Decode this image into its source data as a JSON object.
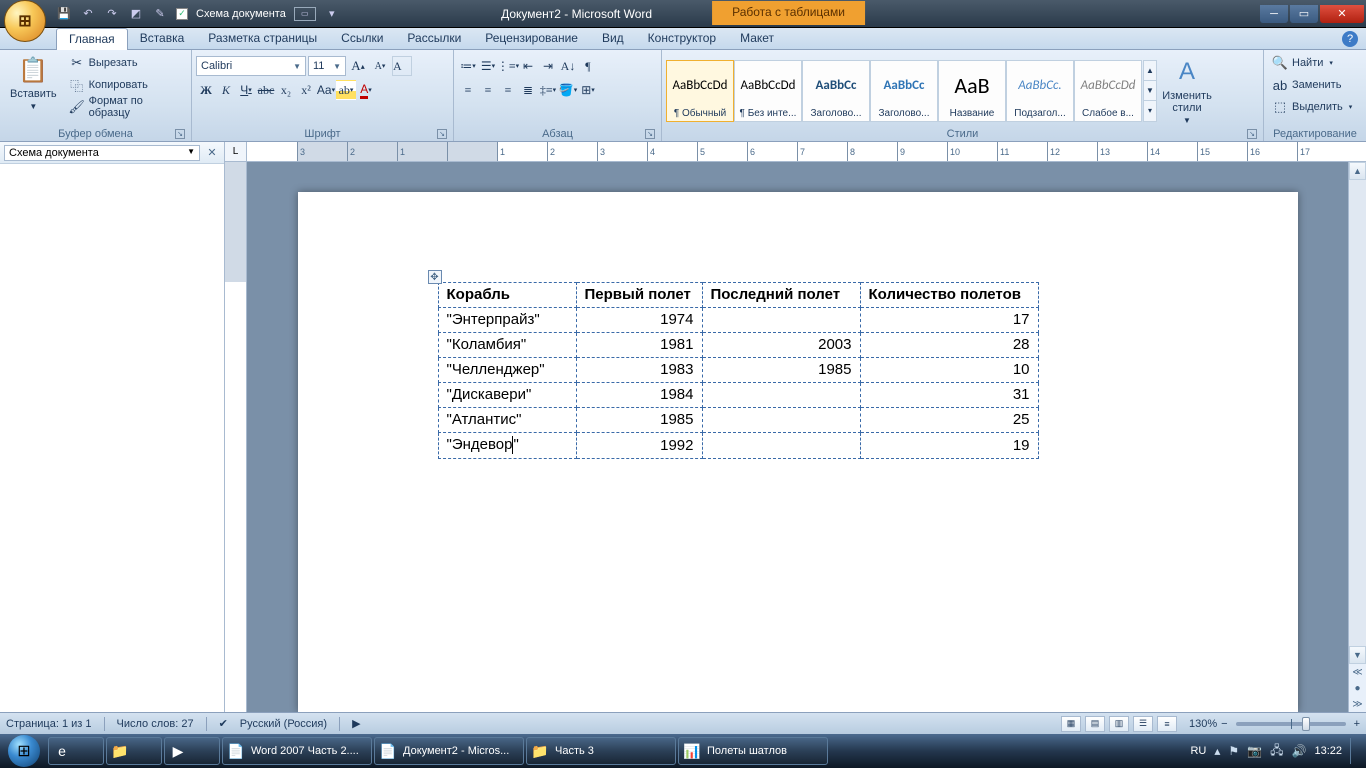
{
  "qat": {
    "schema_label": "Схема документа"
  },
  "title": {
    "document": "Документ2 - Microsoft Word",
    "context": "Работа с таблицами"
  },
  "tabs": {
    "home": "Главная",
    "insert": "Вставка",
    "layout": "Разметка страницы",
    "refs": "Ссылки",
    "mail": "Рассылки",
    "review": "Рецензирование",
    "view": "Вид",
    "design": "Конструктор",
    "tlayout": "Макет"
  },
  "clipboard": {
    "paste": "Вставить",
    "cut": "Вырезать",
    "copy": "Копировать",
    "fmt": "Формат по образцу",
    "group": "Буфер обмена"
  },
  "font": {
    "name": "Calibri",
    "size": "11",
    "group": "Шрифт",
    "bold": "Ж",
    "italic": "К",
    "underline": "Ч",
    "strike": "abc",
    "sub": "x₂",
    "sup": "x²",
    "case": "Aa",
    "clear": "A"
  },
  "para": {
    "group": "Абзац"
  },
  "styles": {
    "group": "Стили",
    "change": "Изменить стили",
    "items": [
      {
        "preview": "AaBbCcDd",
        "name": "¶ Обычный",
        "sel": true,
        "color": "#000"
      },
      {
        "preview": "AaBbCcDd",
        "name": "¶ Без инте...",
        "color": "#000"
      },
      {
        "preview": "AaBbCc",
        "name": "Заголово...",
        "color": "#1f4e79",
        "bold": true
      },
      {
        "preview": "AaBbCc",
        "name": "Заголово...",
        "color": "#2e74b5",
        "bold": true
      },
      {
        "preview": "AaB",
        "name": "Название",
        "color": "#000",
        "size": "22px"
      },
      {
        "preview": "AaBbCc.",
        "name": "Подзагол...",
        "color": "#4a86c5",
        "italic": true
      },
      {
        "preview": "AaBbCcDd",
        "name": "Слабое в...",
        "color": "#808080",
        "italic": true
      }
    ]
  },
  "editing": {
    "find": "Найти",
    "replace": "Заменить",
    "select": "Выделить",
    "group": "Редактирование"
  },
  "navpane": {
    "title": "Схема документа"
  },
  "ruler_ticks": [
    "3",
    "2",
    "1",
    "",
    "1",
    "2",
    "3",
    "4",
    "5",
    "6",
    "7",
    "8",
    "9",
    "10",
    "11",
    "12",
    "13",
    "14",
    "15",
    "16",
    "17"
  ],
  "table": {
    "headers": [
      "Корабль",
      "Первый полет",
      "Последний полет",
      "Количество полетов"
    ],
    "rows": [
      [
        "\"Энтерпрайз\"",
        "1974",
        "",
        "17"
      ],
      [
        "\"Коламбия\"",
        "1981",
        "2003",
        "28"
      ],
      [
        "\"Челленджер\"",
        "1983",
        "1985",
        "10"
      ],
      [
        "\"Дискавери\"",
        "1984",
        "",
        "31"
      ],
      [
        "\"Атлантис\"",
        "1985",
        "",
        "25"
      ],
      [
        "\"Эндевор\"",
        "1992",
        "",
        "19"
      ]
    ]
  },
  "status": {
    "page": "Страница: 1 из 1",
    "words": "Число слов: 27",
    "lang": "Русский (Россия)",
    "zoom": "130%"
  },
  "taskbar": {
    "items": [
      {
        "icon": "📄",
        "label": "Word 2007 Часть 2...."
      },
      {
        "icon": "📄",
        "label": "Документ2 - Micros..."
      },
      {
        "icon": "📁",
        "label": "Часть 3"
      },
      {
        "icon": "📊",
        "label": "Полеты шатлов"
      }
    ],
    "lang": "RU",
    "time": "13:22"
  }
}
